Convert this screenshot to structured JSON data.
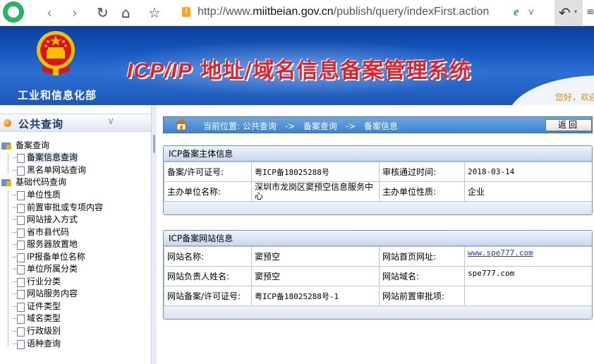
{
  "browser": {
    "url_prefix": "http://www.",
    "url_domain": "miitbeian.gov.cn",
    "url_path": "/publish/query/indexFirst.action",
    "lock_symbol": "!",
    "ie_symbol": "e"
  },
  "header": {
    "ministry": "工业和信息化部",
    "title_en": "ICP/IP",
    "title_cn": " 地址/域名信息备案管理系统",
    "greeting": "您好，欢迎"
  },
  "sidebar": {
    "title": "公共查询",
    "groups": [
      {
        "label": "备案查询",
        "items": [
          {
            "label": "备案信息查询",
            "selected": true
          },
          {
            "label": "黑名单网站查询",
            "selected": false
          }
        ]
      },
      {
        "label": "基础代码查询",
        "items": [
          {
            "label": "单位性质"
          },
          {
            "label": "前置审批或专项内容"
          },
          {
            "label": "网站接入方式"
          },
          {
            "label": "省市县代码"
          },
          {
            "label": "服务器放置地"
          },
          {
            "label": "IP报备单位名称"
          },
          {
            "label": "单位所属分类"
          },
          {
            "label": "行业分类"
          },
          {
            "label": "网站服务内容"
          },
          {
            "label": "证件类型"
          },
          {
            "label": "域名类型"
          },
          {
            "label": "行政级别"
          },
          {
            "label": "语种查询"
          }
        ]
      }
    ]
  },
  "breadcrumb": {
    "current": "当前位置: 公共查询",
    "sep": "->",
    "level2": "备案查询",
    "level3": "备案信息"
  },
  "back_label": "返回",
  "entity_panel": {
    "title": "ICP备案主体信息",
    "rows": [
      [
        "备案/许可证号:",
        "粤ICP备18025288号",
        "审核通过时间:",
        "2018-03-14"
      ],
      [
        "主办单位名称:",
        "深圳市龙岗区窦预空信息服务中心",
        "主办单位性质:",
        "企业"
      ]
    ]
  },
  "site_panel": {
    "title": "ICP备案网站信息",
    "rows": [
      [
        "网站名称:",
        "窦预空",
        "网站首页网址:",
        "www.spe777.com"
      ],
      [
        "网站负责人姓名:",
        "窦预空",
        "网站域名:",
        "spe777.com"
      ],
      [
        "网站备案/许可证号:",
        "粤ICP备18025288号-1",
        "网站前置审批项:",
        ""
      ]
    ]
  },
  "colors": {
    "banner_blue": "#1a5cc4",
    "title_red": "#e0202a",
    "crumb_blue": "#3f82cf",
    "link_blue": "#1a3fb8"
  }
}
